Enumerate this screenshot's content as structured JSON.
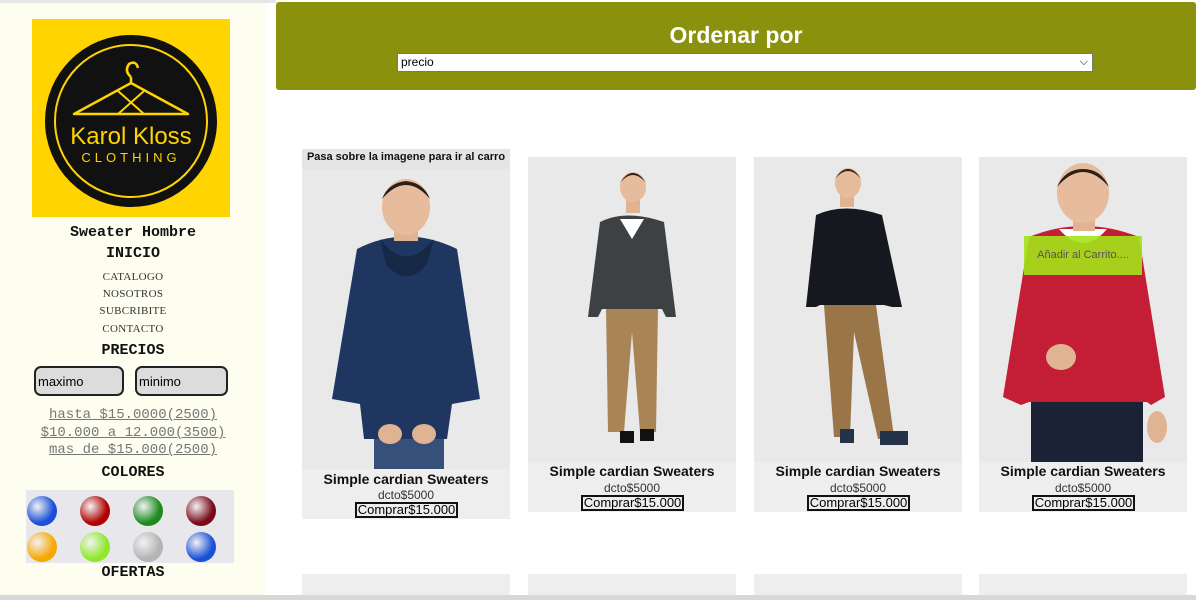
{
  "brand": {
    "logo_line1": "Karol Kloss",
    "logo_line2": "CLOTHING",
    "page_heading": "Sweater Hombre"
  },
  "nav": {
    "home": "INICIO",
    "items": [
      "CATALOGO",
      "NOSOTROS",
      "SUBCRIBITE",
      "CONTACTO"
    ]
  },
  "prices": {
    "title": "PRECIOS",
    "max_placeholder": "maximo",
    "min_placeholder": "minimo",
    "ranges": [
      "hasta $15.0000(2500)",
      "$10.000 a 12.000(3500)",
      "mas de $15.000(2500)"
    ]
  },
  "colors": {
    "title": "COLORES",
    "swatches": [
      "#1a4fd6",
      "#b00000",
      "#1e8a1e",
      "#7a0a1a",
      "#f5a800",
      "#8fe82a",
      "#b4b4b4",
      "#1a4fd6"
    ]
  },
  "offers": {
    "title": "OFERTAS"
  },
  "sort": {
    "title": "Ordenar por",
    "selected": "precio"
  },
  "hover_hint": "Pasa sobre la imagene para ir al carro",
  "add_to_cart": "Añadir al Carrito....",
  "products": [
    {
      "name": "Simple cardian Sweaters",
      "discount": "dcto$5000",
      "buy_label": "Comprar$15.000",
      "sweater_color": "#1e3660",
      "pants_color": "#37507a"
    },
    {
      "name": "Simple cardian Sweaters",
      "discount": "dcto$5000",
      "buy_label": "Comprar$15.000",
      "sweater_color": "#3e4144",
      "pants_color": "#a98456"
    },
    {
      "name": "Simple cardian Sweaters",
      "discount": "dcto$5000",
      "buy_label": "Comprar$15.000",
      "sweater_color": "#15181f",
      "pants_color": "#9a7548"
    },
    {
      "name": "Simple cardian Sweaters",
      "discount": "dcto$5000",
      "buy_label": "Comprar$15.000",
      "sweater_color": "#c41e36",
      "pants_color": "#1b2235"
    }
  ],
  "theme": {
    "header_color": "#8a920d",
    "logo_bg": "#ffd400",
    "add_cart_color": "#a4e41a"
  }
}
